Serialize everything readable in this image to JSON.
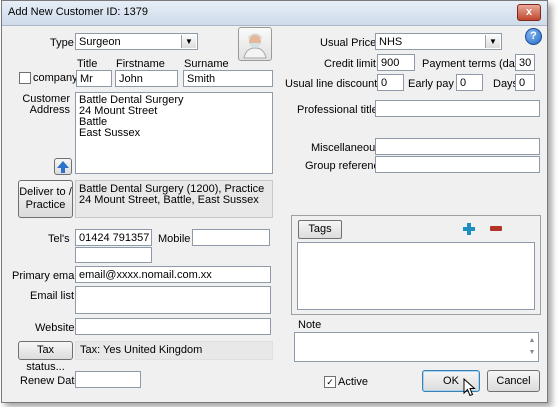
{
  "window": {
    "title": "Add New Customer   ID: 1379",
    "close_glyph": "x"
  },
  "left": {
    "type_label": "Type",
    "type_value": "Surgeon",
    "company_label": "company",
    "title_header": "Title",
    "firstname_header": "Firstname",
    "surname_header": "Surname",
    "title_value": "Mr",
    "firstname_value": "John",
    "surname_value": "Smith",
    "address_label": "Customer Address",
    "address_text": "Battle Dental Surgery\n24 Mount Street\nBattle\nEast Sussex",
    "deliver_button": "Deliver to / Practice",
    "deliver_text": "Battle Dental Surgery (1200), Practice\n24 Mount Street, Battle, East Sussex",
    "tels_label": "Tel's",
    "tel_value": "01424 791357",
    "mobile_label": "Mobile",
    "mobile_value": "",
    "tel2_value": "",
    "primary_email_label": "Primary email",
    "primary_email_value": "email@xxxx.nomail.com.xx",
    "email_list_label": "Email list",
    "email_list_value": "",
    "website_label": "Website",
    "website_value": "",
    "tax_button": "Tax status...",
    "tax_text": "Tax: Yes   United Kingdom",
    "renew_label": "Renew Date",
    "renew_value": ""
  },
  "right": {
    "usual_prices_label": "Usual Prices",
    "usual_prices_value": "NHS",
    "credit_limit_label": "Credit limit",
    "credit_limit_value": "900",
    "payment_terms_label": "Payment terms (days)",
    "payment_terms_value": "30",
    "line_discount_label": "Usual line discount %",
    "line_discount_value": "0",
    "early_pay_label": "Early pay %",
    "early_pay_value": "0",
    "days_label": "Days",
    "days_value": "0",
    "professional_titles_label": "Professional titles",
    "professional_titles_value": "",
    "miscellaneous_label": "Miscellaneous",
    "miscellaneous_value": "",
    "group_reference_label": "Group reference",
    "group_reference_value": "",
    "tags_tab": "Tags",
    "note_label": "Note",
    "note_value": "",
    "active_label": "Active",
    "ok_button": "OK",
    "cancel_button": "Cancel"
  },
  "icons": {
    "help": "help-icon",
    "surgeon": "surgeon-avatar-icon",
    "up_arrow": "arrow-up-icon",
    "add": "plus-icon",
    "remove": "minus-icon",
    "cursor": "mouse-cursor-icon"
  },
  "colors": {
    "add_icon": "#1f8fbf",
    "remove_icon": "#b5342a",
    "help_icon": "#2a6fc9"
  }
}
